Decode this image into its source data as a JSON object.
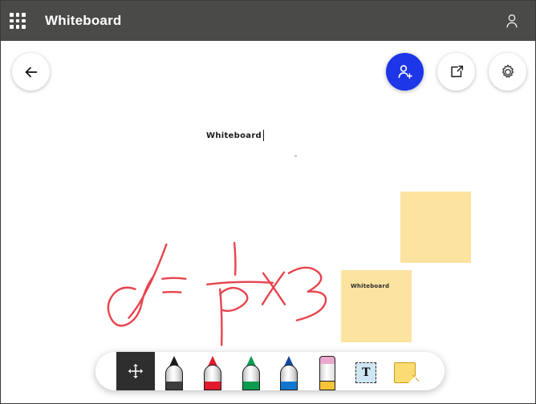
{
  "header": {
    "app_launcher_icon": "app-grid-icon",
    "title": "Whiteboard",
    "account_icon": "person-icon",
    "background_color": "#4a4a48",
    "text_color": "#ffffff"
  },
  "floating_buttons": [
    {
      "name": "back",
      "label": "Back",
      "icon": "arrow-left-icon",
      "style": "light"
    },
    {
      "name": "invite",
      "label": "Invite",
      "icon": "person-add-icon",
      "style": "accent",
      "color": "#1d36e8"
    },
    {
      "name": "share",
      "label": "Share",
      "icon": "open-in-new-icon",
      "style": "light"
    },
    {
      "name": "settings",
      "label": "Settings",
      "icon": "gear-icon",
      "style": "light"
    }
  ],
  "canvas": {
    "background_color": "#ffffff",
    "title_text": "Whiteboard",
    "ink": {
      "color": "#e8434d",
      "expression": "α = 1/p × 3"
    },
    "sticky_notes": [
      {
        "name": "note-top",
        "text": "",
        "color": "#fce3a0"
      },
      {
        "name": "note-bottom",
        "text": "Whiteboard",
        "color": "#fce3a0"
      }
    ]
  },
  "toolbar": {
    "background_color": "#ffffff",
    "selected_tool": "move",
    "selected_background": "#2e2e2e",
    "tools": [
      {
        "name": "move",
        "label": "Move",
        "icon": "move-arrows-icon",
        "color": "#2e2e2e",
        "selected": true
      },
      {
        "name": "pen-black",
        "label": "Black pen",
        "icon": "pen-icon",
        "color": "#1c1c1c",
        "selected": false
      },
      {
        "name": "pen-red",
        "label": "Red pen",
        "icon": "pen-icon",
        "color": "#e01b2c",
        "selected": false
      },
      {
        "name": "pen-green",
        "label": "Green pen",
        "icon": "pen-icon",
        "color": "#0a9b4e",
        "selected": false
      },
      {
        "name": "pen-blue",
        "label": "Blue pen",
        "icon": "pen-icon",
        "color": "#1276d1",
        "selected": false
      },
      {
        "name": "eraser",
        "label": "Eraser",
        "icon": "eraser-icon",
        "color": "#eba8ce",
        "selected": false
      },
      {
        "name": "text",
        "label": "Text",
        "icon": "text-box-icon",
        "glyph": "T",
        "color": "#cfe6f4",
        "selected": false
      },
      {
        "name": "note",
        "label": "Sticky note",
        "icon": "sticky-note-icon",
        "color": "#fbdc72",
        "selected": false
      }
    ]
  }
}
